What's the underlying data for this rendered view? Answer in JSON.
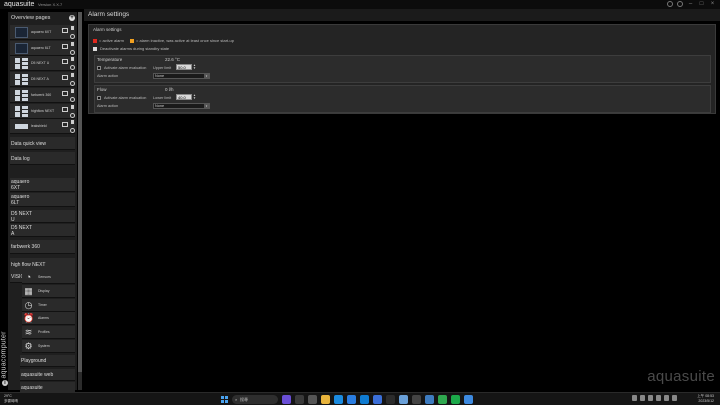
{
  "window": {
    "app_name": "aquasuite",
    "version": "Version X.X.7"
  },
  "sidebar": {
    "overview_header": "Overview pages",
    "overview_items": [
      {
        "label": "aquaero 6XT",
        "thumb": "screenshot"
      },
      {
        "label": "aquaero 6LT",
        "thumb": "screenshot"
      },
      {
        "label": "D5 NEXT U",
        "thumb": "grid"
      },
      {
        "label": "D5 NEXT A",
        "thumb": "grid"
      },
      {
        "label": "farbwerk 360",
        "thumb": "grid"
      },
      {
        "label": "highflow NEXT",
        "thumb": "grid"
      },
      {
        "label": "leakshield",
        "thumb": "bar"
      }
    ],
    "nav_items": [
      {
        "lines": [
          "Data quick view"
        ]
      },
      {
        "lines": [
          "Data log"
        ]
      },
      {
        "lines": [
          "aquaero",
          "6XT"
        ]
      },
      {
        "lines": [
          "aquaero",
          "6LT"
        ]
      },
      {
        "lines": [
          "D5 NEXT",
          "U"
        ]
      },
      {
        "lines": [
          "D5 NEXT",
          "A"
        ]
      },
      {
        "lines": [
          "farbwerk 360"
        ]
      },
      {
        "lines": [
          "high flow NEXT"
        ]
      },
      {
        "lines": [
          "VISION"
        ]
      }
    ],
    "tools": [
      {
        "label": "Sensors",
        "icon": "gauge-icon",
        "glyph": "◔"
      },
      {
        "label": "Display",
        "icon": "display-icon",
        "glyph": "▦"
      },
      {
        "label": "Timer",
        "icon": "timer-icon",
        "glyph": "◷"
      },
      {
        "label": "Alarms",
        "icon": "alarm-icon",
        "glyph": "⏰"
      },
      {
        "label": "Profiles",
        "icon": "profiles-icon",
        "glyph": "≋"
      },
      {
        "label": "System",
        "icon": "gear-icon",
        "glyph": "⚙"
      }
    ],
    "bottom_items": [
      {
        "lines": [
          "Playground"
        ]
      },
      {
        "lines": [
          "aquasuite web"
        ]
      },
      {
        "lines": [
          "aquasuite"
        ]
      }
    ],
    "brand": "aquacomputer"
  },
  "main": {
    "header": "Alarm settings",
    "panel_title": "Alarm settings",
    "legend": [
      {
        "color": "#e0281e",
        "text": "= active alarm"
      },
      {
        "color": "#f0a020",
        "text": "= alarm inactive, was active at least once since start-up"
      }
    ],
    "deactivate_label": "Deactivate alarms during standby state",
    "sections": [
      {
        "title": "Temperature",
        "value": "22.6 °C",
        "activate_label": "Activate alarm evaluation",
        "limit_label": "Upper limit",
        "limit_value": "50.0",
        "action_label": "Alarm action",
        "action_value": "None"
      },
      {
        "title": "Flow",
        "value": "0 l/h",
        "activate_label": "Activate alarm evaluation",
        "limit_label": "Lower limit",
        "limit_value": "40.0",
        "action_label": "Alarm action",
        "action_value": "None"
      }
    ]
  },
  "watermark": "aquasuite",
  "taskbar": {
    "weather_temp": "29°C",
    "weather_desc": "多雲時晴",
    "search_placeholder": "搜尋",
    "time": "上午 08:53",
    "date": "2023/5/12"
  }
}
